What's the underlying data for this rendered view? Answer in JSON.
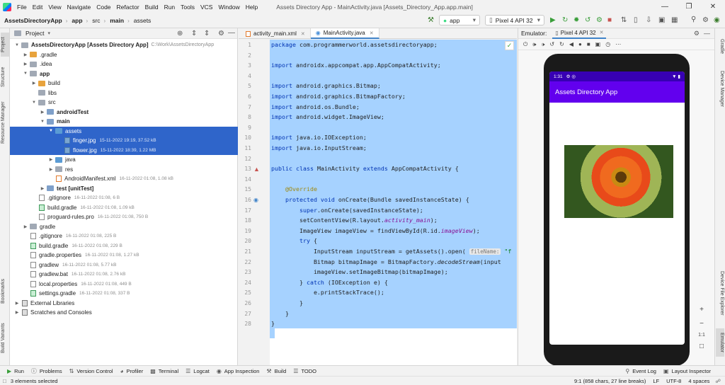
{
  "menu": [
    "File",
    "Edit",
    "View",
    "Navigate",
    "Code",
    "Refactor",
    "Build",
    "Run",
    "Tools",
    "VCS",
    "Window",
    "Help"
  ],
  "window_title": "Assets Directory App - MainActivity.java [Assets_Directory_App.app.main]",
  "breadcrumbs": [
    "AssetsDirectoryApp",
    "app",
    "src",
    "main",
    "assets"
  ],
  "run_config": "app",
  "device": "Pixel 4 API 32",
  "left_tabs": [
    "Project",
    "Structure",
    "Resource Manager",
    "Bookmarks",
    "Build Variants"
  ],
  "right_tabs": [
    "Gradle",
    "Device Manager",
    "Device File Explorer",
    "Emulator"
  ],
  "project": {
    "title": "Project",
    "tree": [
      {
        "label": "AssetsDirectoryApp [Assets Directory App]",
        "meta": "C:\\Work\\AssetsDirectoryApp",
        "indent": 0,
        "icon": "folder-module",
        "bold": true,
        "arrow": "down"
      },
      {
        "label": ".gradle",
        "indent": 1,
        "icon": "folder-orange",
        "arrow": "right"
      },
      {
        "label": ".idea",
        "indent": 1,
        "icon": "folder",
        "arrow": "right"
      },
      {
        "label": "app",
        "indent": 1,
        "icon": "folder-module",
        "bold": true,
        "arrow": "down"
      },
      {
        "label": "build",
        "indent": 2,
        "icon": "folder-orange",
        "arrow": "right"
      },
      {
        "label": "libs",
        "indent": 2,
        "icon": "folder",
        "arrow": ""
      },
      {
        "label": "src",
        "indent": 2,
        "icon": "folder",
        "arrow": "down"
      },
      {
        "label": "androidTest",
        "indent": 3,
        "icon": "folder-src",
        "bold": true,
        "arrow": "right"
      },
      {
        "label": "main",
        "indent": 3,
        "icon": "folder-src",
        "bold": true,
        "arrow": "down"
      },
      {
        "label": "assets",
        "indent": 4,
        "icon": "folder-blue",
        "arrow": "down",
        "selected": true
      },
      {
        "label": "finger.jpg",
        "meta": "15-11-2022 19:19, 37.52 kB",
        "indent": 5,
        "icon": "image-file",
        "selected": true
      },
      {
        "label": "flower.jpg",
        "meta": "15-11-2022 18:39, 1.22 MB",
        "indent": 5,
        "icon": "image-file",
        "selected": true
      },
      {
        "label": "java",
        "indent": 4,
        "icon": "folder-blue",
        "arrow": "right"
      },
      {
        "label": "res",
        "indent": 4,
        "icon": "folder",
        "arrow": "right"
      },
      {
        "label": "AndroidManifest.xml",
        "meta": "16-11-2022 01:08, 1.08 kB",
        "indent": 4,
        "icon": "xml-file"
      },
      {
        "label": "test [unitTest]",
        "indent": 3,
        "icon": "folder-src",
        "bold": true,
        "arrow": "right"
      },
      {
        "label": ".gitignore",
        "meta": "16-11-2022 01:08, 6 B",
        "indent": 2,
        "icon": "file"
      },
      {
        "label": "build.gradle",
        "meta": "16-11-2022 01:08, 1.09 kB",
        "indent": 2,
        "icon": "gradle-file"
      },
      {
        "label": "proguard-rules.pro",
        "meta": "16-11-2022 01:08, 750 B",
        "indent": 2,
        "icon": "file"
      },
      {
        "label": "gradle",
        "indent": 1,
        "icon": "folder",
        "arrow": "right"
      },
      {
        "label": ".gitignore",
        "meta": "16-11-2022 01:08, 225 B",
        "indent": 1,
        "icon": "file"
      },
      {
        "label": "build.gradle",
        "meta": "16-11-2022 01:08, 229 B",
        "indent": 1,
        "icon": "gradle-file"
      },
      {
        "label": "gradle.properties",
        "meta": "16-11-2022 01:08, 1.27 kB",
        "indent": 1,
        "icon": "file"
      },
      {
        "label": "gradlew",
        "meta": "16-11-2022 01:08, 5.77 kB",
        "indent": 1,
        "icon": "file"
      },
      {
        "label": "gradlew.bat",
        "meta": "16-11-2022 01:08, 2.76 kB",
        "indent": 1,
        "icon": "file"
      },
      {
        "label": "local.properties",
        "meta": "16-11-2022 01:08, 449 B",
        "indent": 1,
        "icon": "file"
      },
      {
        "label": "settings.gradle",
        "meta": "16-11-2022 01:08, 337 B",
        "indent": 1,
        "icon": "gradle-file"
      },
      {
        "label": "External Libraries",
        "indent": 0,
        "icon": "library",
        "arrow": "right"
      },
      {
        "label": "Scratches and Consoles",
        "indent": 0,
        "icon": "library",
        "arrow": "right"
      }
    ]
  },
  "editor": {
    "tabs": [
      {
        "label": "activity_main.xml",
        "active": false
      },
      {
        "label": "MainActivity.java",
        "active": true
      }
    ],
    "lines": [
      "<k>package</k> com.programmerworld.assetsdirectoryapp;",
      "",
      "<k>import</k> androidx.appcompat.app.AppCompatActivity;",
      "",
      "<k>import</k> android.graphics.Bitmap;",
      "<k>import</k> android.graphics.BitmapFactory;",
      "<k>import</k> android.os.Bundle;",
      "<k>import</k> android.widget.ImageView;",
      "",
      "<k>import</k> java.io.IOException;",
      "<k>import</k> java.io.InputStream;",
      "",
      "<k>public class</k> MainActivity <k>extends</k> AppCompatActivity {",
      "",
      "    <a>@Override</a>",
      "    <k>protected void</k> onCreate(Bundle savedInstanceState) {",
      "        <k>super</k>.onCreate(savedInstanceState);",
      "        setContentView(R.layout.<i>activity_main</i>);",
      "        ImageView imageView = findViewById(R.id.<i>imageView</i>);",
      "        <k>try</k> {",
      "            InputStream inputStream = getAssets().open( <h>fileName:</h> <s>\"f</s>",
      "            Bitmap bitmapImage = BitmapFactory.<em>decodeStream</em>(input",
      "            imageView.setImageBitmap(bitmapImage);",
      "        } <k>catch</k> (IOException e) {",
      "            e.printStackTrace();",
      "        }",
      "    }",
      "}"
    ]
  },
  "emulator": {
    "label": "Emulator:",
    "device_tab": "Pixel 4 API 32",
    "status_time": "1:31",
    "app_title": "Assets Directory App",
    "zoom_ratio": "1:1"
  },
  "bottom_tools": [
    "Run",
    "Problems",
    "Version Control",
    "Profiler",
    "Terminal",
    "Logcat",
    "App Inspection",
    "Build",
    "TODO"
  ],
  "bottom_right": [
    "Event Log",
    "Layout Inspector"
  ],
  "status": {
    "left": "3 elements selected",
    "position": "9:1 (858 chars, 27 line breaks)",
    "line_sep": "LF",
    "encoding": "UTF-8",
    "indent": "4 spaces"
  },
  "colors": {
    "accent": "#2f65ca",
    "app_bar": "#6200ee",
    "status_bar": "#3700b3",
    "selection": "#a6d2ff"
  }
}
